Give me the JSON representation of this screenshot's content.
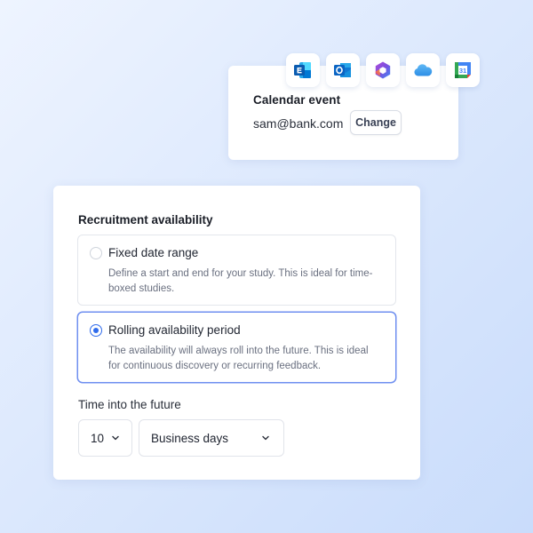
{
  "calendar_card": {
    "title": "Calendar event",
    "email": "sam@bank.com",
    "change_label": "Change"
  },
  "app_icons": [
    {
      "name": "exchange-icon"
    },
    {
      "name": "outlook-icon"
    },
    {
      "name": "microsoft-365-icon"
    },
    {
      "name": "icloud-icon"
    },
    {
      "name": "google-calendar-icon",
      "text": "31"
    }
  ],
  "recruitment": {
    "title": "Recruitment availability",
    "options": [
      {
        "label": "Fixed date range",
        "description": "Define a start and end for your study. This is ideal for time-boxed studies.",
        "selected": false
      },
      {
        "label": "Rolling availability period",
        "description": "The availability will always roll into the future. This is ideal for continuous discovery or recurring feedback.",
        "selected": true
      }
    ],
    "future_label": "Time into the future",
    "amount_value": "10",
    "unit_value": "Business days"
  },
  "colors": {
    "accent": "#2f6bec",
    "selected_border": "#6f8ff0"
  }
}
